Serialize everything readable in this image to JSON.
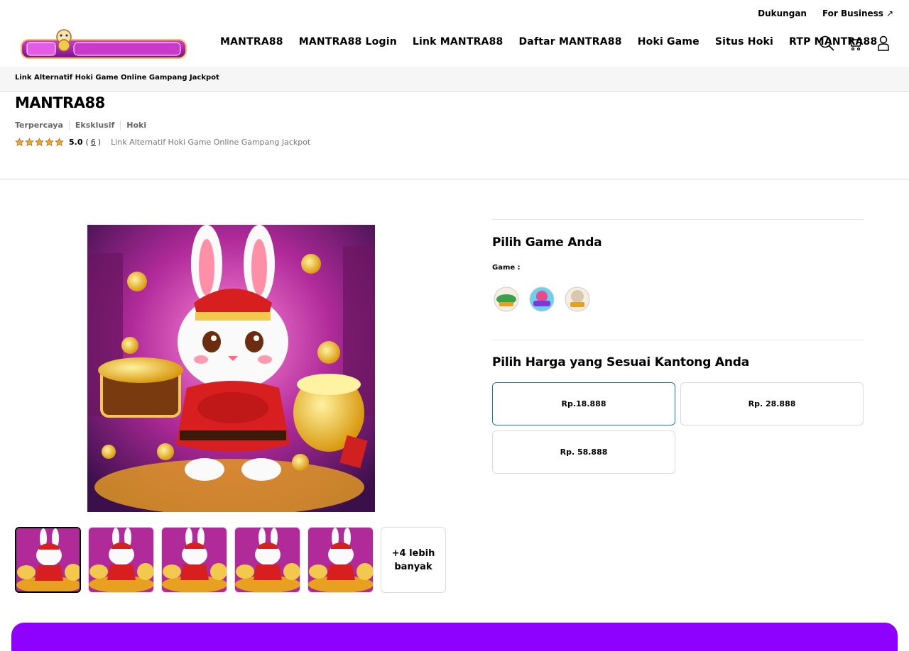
{
  "utility": {
    "support": "Dukungan",
    "business": "For Business"
  },
  "nav": {
    "items": [
      "MANTRA88",
      "MANTRA88 Login",
      "Link MANTRA88",
      "Daftar MANTRA88",
      "Hoki Game",
      "Situs Hoki",
      "RTP MANTRA88"
    ]
  },
  "subnav": {
    "text": "Link Alternatif Hoki Game Online Gampang Jackpot"
  },
  "product": {
    "title": "MANTRA88",
    "tags": [
      "Terpercaya",
      "Eksklusif",
      "Hoki"
    ],
    "rating": "5.0",
    "review_count": "6",
    "description": "Link Alternatif Hoki Game Online Gampang Jackpot",
    "star_count": 5
  },
  "gallery": {
    "more_label": "+4 lebih banyak"
  },
  "options": {
    "game_section_title": "Pilih Game Anda",
    "game_label": "Game :",
    "price_section_title": "Pilih Harga yang Sesuai Kantong Anda",
    "prices": [
      "Rp.18.888",
      "Rp. 28.888",
      "Rp. 58.888"
    ],
    "selected_price_index": 0
  },
  "colors": {
    "accent": "#8e00ff",
    "selected_border": "#1a73b8",
    "logo_magenta": "#a020a0"
  }
}
